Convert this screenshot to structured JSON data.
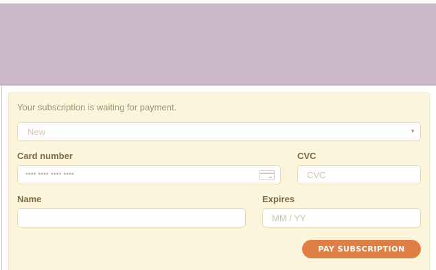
{
  "status": {
    "message": "Your subscription is waiting for payment."
  },
  "plan_select": {
    "value": "New"
  },
  "form": {
    "card_number_label": "Card number",
    "card_number_placeholder": "•••• •••• •••• ••••",
    "cvc_label": "CVC",
    "cvc_placeholder": "CVC",
    "name_label": "Name",
    "name_value": "",
    "expires_label": "Expires",
    "expires_placeholder": "MM / YY"
  },
  "actions": {
    "pay_label": "PAY SUBSCRIPTION"
  },
  "icons": {
    "select_caret": "chevron-down-icon",
    "card": "credit-card-icon"
  },
  "colors": {
    "banner": "#cdb8ca",
    "panel": "#fcf5dc",
    "accent_button": "#e07f45",
    "label": "#7b6a47"
  }
}
